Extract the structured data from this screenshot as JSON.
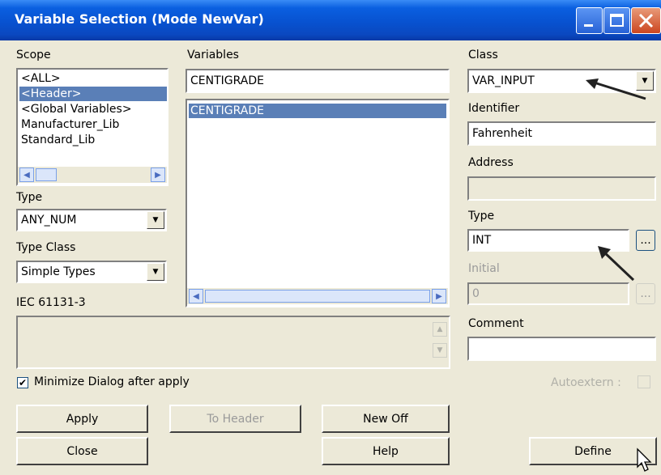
{
  "window": {
    "title": "Variable Selection (Mode NewVar)"
  },
  "scope": {
    "label": "Scope",
    "items": [
      "<ALL>",
      "<Header>",
      "<Global Variables>",
      "Manufacturer_Lib",
      "Standard_Lib"
    ],
    "selected_index": 1
  },
  "variables": {
    "label": "Variables",
    "filter_value": "CENTIGRADE",
    "items": [
      "CENTIGRADE"
    ]
  },
  "left_type": {
    "label": "Type",
    "value": "ANY_NUM"
  },
  "type_class": {
    "label": "Type Class",
    "value": "Simple Types"
  },
  "iec_label": "IEC 61131-3",
  "right": {
    "class_label": "Class",
    "class_value": "VAR_INPUT",
    "identifier_label": "Identifier",
    "identifier_value": "Fahrenheit",
    "address_label": "Address",
    "address_value": "",
    "type_label": "Type",
    "type_value": "INT",
    "browse_label": "...",
    "initial_label": "Initial",
    "initial_value": "0",
    "comment_label": "Comment",
    "comment_value": ""
  },
  "options": {
    "minimize_label": "Minimize  Dialog after apply",
    "minimize_checked": true,
    "autoextern_label": "Autoextern :"
  },
  "buttons": {
    "apply": "Apply",
    "to_header": "To Header",
    "new_off": "New Off",
    "close": "Close",
    "help": "Help",
    "define": "Define"
  },
  "colors": {
    "title_bar": "#0a5fe0",
    "selection": "#5a7fb7",
    "dialog_bg": "#ece9d8"
  }
}
